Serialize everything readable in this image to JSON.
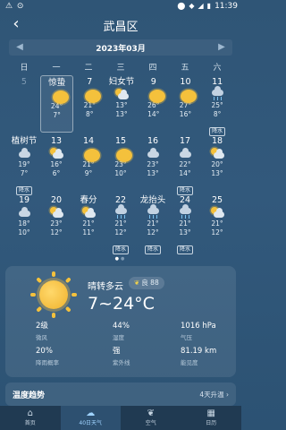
{
  "status_bar": {
    "left_icons": "⚠ ⊙",
    "time": "11:39"
  },
  "header": {
    "title": "武昌区"
  },
  "month": {
    "label": "2023年03月"
  },
  "weekdays": [
    "日",
    "一",
    "二",
    "三",
    "四",
    "五",
    "六"
  ],
  "calendar": [
    [
      {
        "day": "5",
        "dim": true
      },
      {
        "day": "惊蛰",
        "icon": "sun",
        "hi": "24°",
        "lo": "7°",
        "selected": true
      },
      {
        "day": "7",
        "icon": "sun",
        "hi": "21°",
        "lo": "8°"
      },
      {
        "day": "妇女节",
        "icon": "pc",
        "hi": "13°",
        "lo": "13°"
      },
      {
        "day": "9",
        "icon": "sun",
        "hi": "26°",
        "lo": "14°"
      },
      {
        "day": "10",
        "icon": "sun",
        "hi": "27°",
        "lo": "16°"
      },
      {
        "day": "11",
        "icon": "rain",
        "hi": "25°",
        "lo": "8°",
        "badge": "降水"
      }
    ],
    [
      {
        "day": "植树节",
        "icon": "cloudy",
        "hi": "19°",
        "lo": "7°",
        "badge": "降水"
      },
      {
        "day": "13",
        "icon": "pc",
        "hi": "16°",
        "lo": "6°"
      },
      {
        "day": "14",
        "icon": "sun",
        "hi": "21°",
        "lo": "9°"
      },
      {
        "day": "15",
        "icon": "sun",
        "hi": "23°",
        "lo": "10°"
      },
      {
        "day": "16",
        "icon": "cloudy",
        "hi": "23°",
        "lo": "13°"
      },
      {
        "day": "17",
        "icon": "cloudy",
        "hi": "22°",
        "lo": "14°",
        "badge": "降水"
      },
      {
        "day": "18",
        "icon": "pc",
        "hi": "20°",
        "lo": "13°"
      }
    ],
    [
      {
        "day": "19",
        "icon": "cloudy",
        "hi": "18°",
        "lo": "10°"
      },
      {
        "day": "20",
        "icon": "pc",
        "hi": "23°",
        "lo": "12°"
      },
      {
        "day": "春分",
        "icon": "pc",
        "hi": "21°",
        "lo": "11°"
      },
      {
        "day": "22",
        "icon": "rain",
        "hi": "21°",
        "lo": "12°",
        "badge": "降水"
      },
      {
        "day": "龙抬头",
        "icon": "rain",
        "hi": "21°",
        "lo": "12°",
        "badge": "降水"
      },
      {
        "day": "24",
        "icon": "rain",
        "hi": "21°",
        "lo": "13°",
        "badge": "降水"
      },
      {
        "day": "25",
        "icon": "pc",
        "hi": "21°",
        "lo": "12°"
      }
    ]
  ],
  "detail": {
    "condition": "晴转多云",
    "aqi": "良 88",
    "temp_range": "7~24°C",
    "stats": [
      {
        "value": "2级",
        "label": "微风"
      },
      {
        "value": "44%",
        "label": "湿度"
      },
      {
        "value": "1016 hPa",
        "label": "气压"
      },
      {
        "value": "20%",
        "label": "降雨概率"
      },
      {
        "value": "强",
        "label": "紫外线"
      },
      {
        "value": "81.19 km",
        "label": "能见度"
      }
    ]
  },
  "trend": {
    "title": "温度趋势",
    "hint": "4天升温"
  },
  "tabs": [
    {
      "label": "首页",
      "icon": "home-icon"
    },
    {
      "label": "40日天气",
      "icon": "cloud-icon",
      "active": true
    },
    {
      "label": "空气",
      "icon": "leaf-icon"
    },
    {
      "label": "日历",
      "icon": "calendar-icon"
    }
  ]
}
